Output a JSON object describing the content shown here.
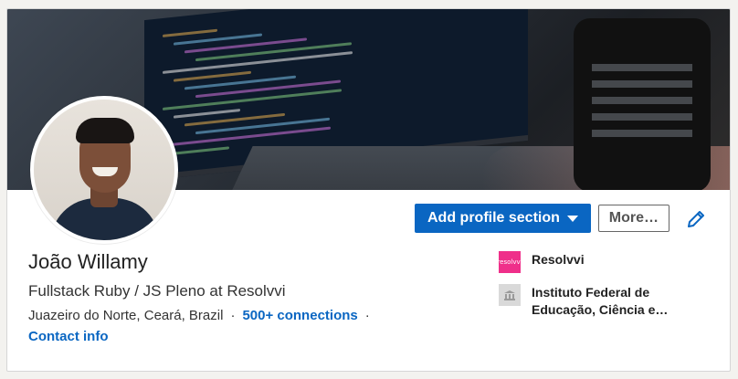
{
  "profile": {
    "name": "João Willamy",
    "headline": "Fullstack Ruby / JS Pleno at Resolvvi",
    "location": "Juazeiro do Norte, Ceará, Brazil",
    "separator": "·",
    "connections": "500+ connections",
    "contact_info": "Contact info"
  },
  "actions": {
    "add_profile_section": "Add profile section",
    "more": "More…"
  },
  "experience": [
    {
      "label": "Resolvvi",
      "logo_text": "resolvvi",
      "logo_color": "#ef2f8a"
    },
    {
      "label": "Instituto Federal de Educação, Ciência e…",
      "logo_color": "#d9d9d9"
    }
  ],
  "colors": {
    "accent": "#0a66c2"
  },
  "icons": {
    "edit": "pencil-icon",
    "dropdown": "caret-down-icon",
    "school": "school-icon"
  }
}
